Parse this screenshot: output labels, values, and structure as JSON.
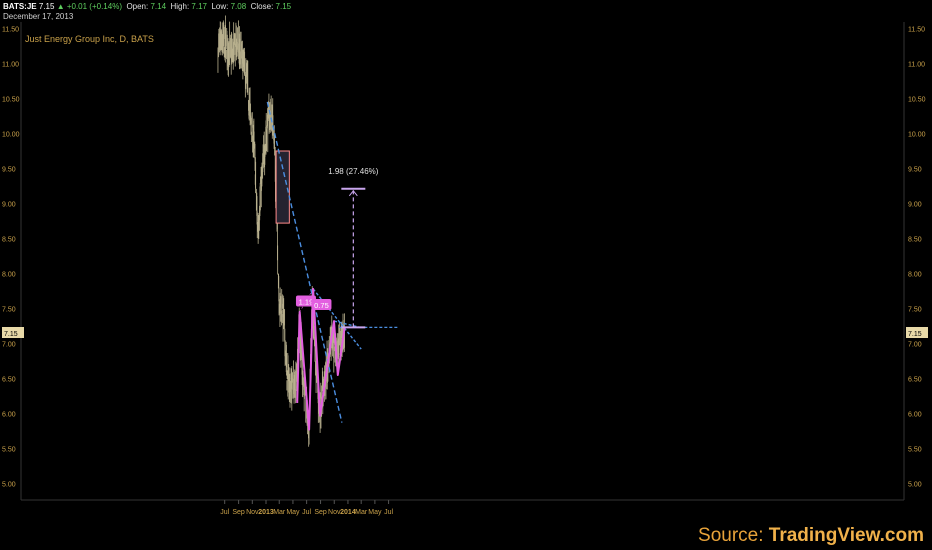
{
  "header": {
    "symbol": "BATS:JE",
    "price": "7.15",
    "change": "▲ +0.01 (+0.14%)",
    "open_label": "Open:",
    "open": "7.14",
    "high_label": "High:",
    "high": "7.17",
    "low_label": "Low:",
    "low": "7.08",
    "close_label": "Close:",
    "close": "7.15",
    "date": "December 17, 2013"
  },
  "source": {
    "prefix": "Source: ",
    "brand": "TradingView.com"
  },
  "colors": {
    "background": "#000000",
    "bars": "#b8b08e",
    "trendline": "#4b8ee0",
    "pattern": "#e35fe0",
    "measure": "#c9a6ee",
    "axis_text": "#c9a14a",
    "rect_fill": "#252330",
    "rect_stroke": "#ff8a8a"
  },
  "chart_data": {
    "type": "ohlc",
    "title": "Just Energy Group Inc, D, BATS",
    "y_ticks": [
      "11.50",
      "11.00",
      "10.50",
      "10.00",
      "9.50",
      "9.00",
      "8.50",
      "8.00",
      "7.50",
      "7.00",
      "6.50",
      "6.00",
      "5.50",
      "5.00"
    ],
    "x_ticks": [
      "Jul",
      "Sep",
      "Nov",
      "2013",
      "Mar",
      "May",
      "Jul",
      "Sep",
      "Nov",
      "2014",
      "Mar",
      "May",
      "Jul"
    ],
    "ylim": [
      4.8,
      11.6
    ],
    "last_price_label": "7.15",
    "price_path": [
      [
        "2012-06-01",
        11.2
      ],
      [
        "2012-06-20",
        11.3
      ],
      [
        "2012-07-10",
        11.25
      ],
      [
        "2012-08-01",
        11.1
      ],
      [
        "2012-08-25",
        11.3
      ],
      [
        "2012-09-15",
        11.05
      ],
      [
        "2012-10-05",
        10.8
      ],
      [
        "2012-10-25",
        10.2
      ],
      [
        "2012-11-10",
        9.8
      ],
      [
        "2012-11-25",
        8.6
      ],
      [
        "2012-12-15",
        9.4
      ],
      [
        "2013-01-05",
        10.1
      ],
      [
        "2013-01-20",
        10.3
      ],
      [
        "2013-02-05",
        10.1
      ],
      [
        "2013-02-18",
        8.8
      ],
      [
        "2013-03-01",
        7.6
      ],
      [
        "2013-03-20",
        7.4
      ],
      [
        "2013-04-05",
        6.5
      ],
      [
        "2013-04-25",
        6.4
      ],
      [
        "2013-05-15",
        6.4
      ],
      [
        "2013-05-28",
        7.35
      ],
      [
        "2013-06-15",
        6.5
      ],
      [
        "2013-07-01",
        6.05
      ],
      [
        "2013-07-12",
        5.85
      ],
      [
        "2013-07-25",
        7.5
      ],
      [
        "2013-08-10",
        6.8
      ],
      [
        "2013-08-25",
        6.1
      ],
      [
        "2013-09-10",
        6.3
      ],
      [
        "2013-09-30",
        6.6
      ],
      [
        "2013-10-20",
        7.2
      ],
      [
        "2013-11-05",
        6.9
      ],
      [
        "2013-11-15",
        6.9
      ],
      [
        "2013-11-30",
        7.05
      ],
      [
        "2013-12-17",
        7.15
      ]
    ],
    "pattern_points": [
      [
        "2013-05-20",
        6.15
      ],
      [
        "2013-05-31",
        7.45
      ],
      [
        "2013-07-12",
        5.77
      ],
      [
        "2013-07-30",
        7.78
      ],
      [
        "2013-08-30",
        5.97
      ],
      [
        "2013-10-31",
        7.32
      ],
      [
        "2013-11-17",
        6.55
      ],
      [
        "2013-12-17",
        7.23
      ]
    ],
    "pattern_labels": [
      {
        "text": "1.19",
        "date": "2013-06-28",
        "price": 7.6
      },
      {
        "text": "0.75",
        "date": "2013-09-05",
        "price": 7.55
      }
    ],
    "downtrend_line": {
      "from": [
        "2013-01-07",
        10.45
      ],
      "to": [
        "2013-12-05",
        5.87
      ]
    },
    "triangle_upper_line": {
      "from": [
        "2013-07-30",
        7.78
      ],
      "to": [
        "2014-03-01",
        6.92
      ]
    },
    "triangle_lower_line": {
      "from": [
        "2013-10-31",
        7.32
      ],
      "to": [
        "2014-02-25",
        7.23
      ]
    },
    "target_box": {
      "from": [
        "2013-02-15",
        9.75
      ],
      "to": [
        "2013-04-15",
        8.72
      ]
    },
    "projection": {
      "date": "2014-01-25",
      "from_price": 7.23,
      "to_price": 9.21,
      "label": "1.98 (27.46%)"
    }
  }
}
